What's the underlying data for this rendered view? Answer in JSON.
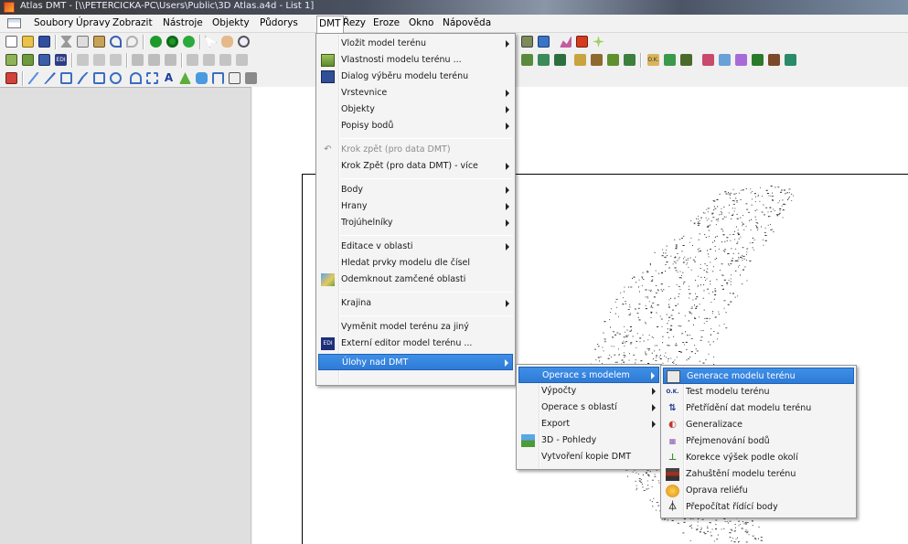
{
  "window": {
    "title": "Atlas DMT - [\\\\PETERCICKA-PC\\Users\\Public\\3D Atlas.a4d - List 1]"
  },
  "menubar": {
    "items": [
      "Soubory",
      "Úpravy",
      "Zobrazit",
      "Nástroje",
      "Objekty",
      "Půdorys",
      "DMT",
      "Řezy",
      "Eroze",
      "Okno",
      "Nápověda"
    ],
    "active": "DMT"
  },
  "dmt_menu": {
    "items": [
      {
        "label": "Vložit model terénu",
        "submenu": true,
        "icon": "none"
      },
      {
        "label": "Vlastnosti modelu terénu ...",
        "icon": "terrain-properties-icon"
      },
      {
        "label": "Dialog výběru modelu terénu",
        "icon": "terrain-dialog-icon"
      },
      {
        "label": "Vrstevnice",
        "submenu": true
      },
      {
        "label": "Objekty",
        "submenu": true
      },
      {
        "label": "Popisy bodů",
        "submenu": true
      },
      {
        "label": "Krok zpět (pro data DMT)",
        "disabled": true,
        "icon": "undo-icon"
      },
      {
        "label": "Krok Zpět (pro data DMT) - více",
        "submenu": true
      },
      {
        "label": "Body",
        "submenu": true
      },
      {
        "label": "Hrany",
        "submenu": true
      },
      {
        "label": "Trojúhelníky",
        "submenu": true
      },
      {
        "label": "Editace v oblasti",
        "submenu": true
      },
      {
        "label": "Hledat prvky modelu dle čísel"
      },
      {
        "label": "Odemknout zamčené oblasti",
        "icon": "unlock-area-icon"
      },
      {
        "label": "Krajina",
        "submenu": true
      },
      {
        "label": "Vyměnit model terénu za jiný"
      },
      {
        "label": "Externí editor model terénu ...",
        "icon": "edi-dmt-icon"
      },
      {
        "label": "Úlohy nad DMT",
        "submenu": true,
        "highlighted": true
      }
    ]
  },
  "ulohy_menu": {
    "items": [
      {
        "label": "Operace s modelem",
        "submenu": true,
        "highlighted": true
      },
      {
        "label": "Výpočty",
        "submenu": true
      },
      {
        "label": "Operace s oblastí",
        "submenu": true
      },
      {
        "label": "Export",
        "submenu": true
      },
      {
        "label": "3D - Pohledy",
        "icon": "3d-view-icon"
      },
      {
        "label": "Vytvoření kopie DMT"
      }
    ]
  },
  "operace_menu": {
    "items": [
      {
        "label": "Generace modelu terénu",
        "icon": "generate-model-icon",
        "highlighted": true
      },
      {
        "label": "Test modelu terénu",
        "icon": "ok-test-icon"
      },
      {
        "label": "Přetřídění dat modelu terénu",
        "icon": "resort-icon"
      },
      {
        "label": "Generalizace",
        "icon": "generalize-icon"
      },
      {
        "label": "Přejmenování bodů",
        "icon": "rename-points-icon"
      },
      {
        "label": "Korekce výšek podle okolí",
        "icon": "height-correction-icon"
      },
      {
        "label": "Zahuštění modelu terénu",
        "icon": "densify-icon"
      },
      {
        "label": "Oprava reliéfu",
        "icon": "relief-repair-icon"
      },
      {
        "label": "Přepočítat řídící body",
        "icon": "recalc-control-points-icon"
      }
    ]
  },
  "colors": {
    "highlight": "#3385dd",
    "menu_bg": "#f4f4f4",
    "panel": "#dfdfdf"
  }
}
